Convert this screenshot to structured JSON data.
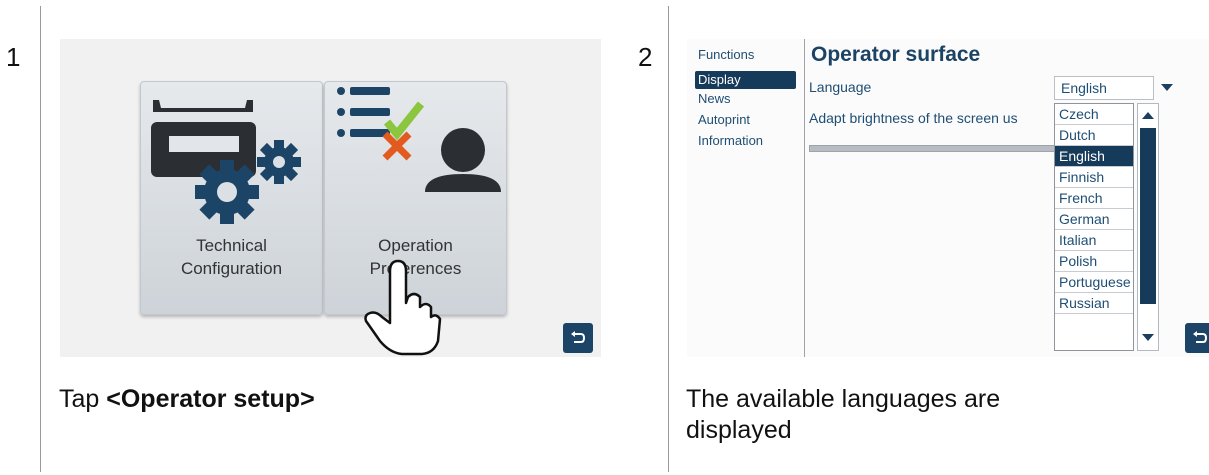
{
  "step1": {
    "number": "1",
    "tiles": [
      {
        "label_line1": "Technical",
        "label_line2": "Configuration",
        "icon": "scale-gears-icon"
      },
      {
        "label_line1": "Operation",
        "label_line2": "Preferences",
        "icon": "user-checklist-icon"
      }
    ],
    "caption_prefix": "Tap ",
    "caption_bold": "<Operator setup>"
  },
  "step2": {
    "number": "2",
    "sidebar": [
      "Functions",
      "Display",
      "News",
      "Autoprint",
      "Information"
    ],
    "sidebar_active_index": 1,
    "title": "Operator surface",
    "language_label": "Language",
    "brightness_label": "Adapt brightness of the screen us",
    "language_value": "English",
    "languages": [
      "Czech",
      "Dutch",
      "English",
      "Finnish",
      "French",
      "German",
      "Italian",
      "Polish",
      "Portuguese",
      "Russian"
    ],
    "selected_language": "English",
    "caption_line1": "The available languages are",
    "caption_line2": "displayed"
  },
  "colors": {
    "accent": "#163a5a",
    "link_text": "#1f4e74",
    "check": "#8cc63f",
    "cross": "#e35a1f"
  }
}
